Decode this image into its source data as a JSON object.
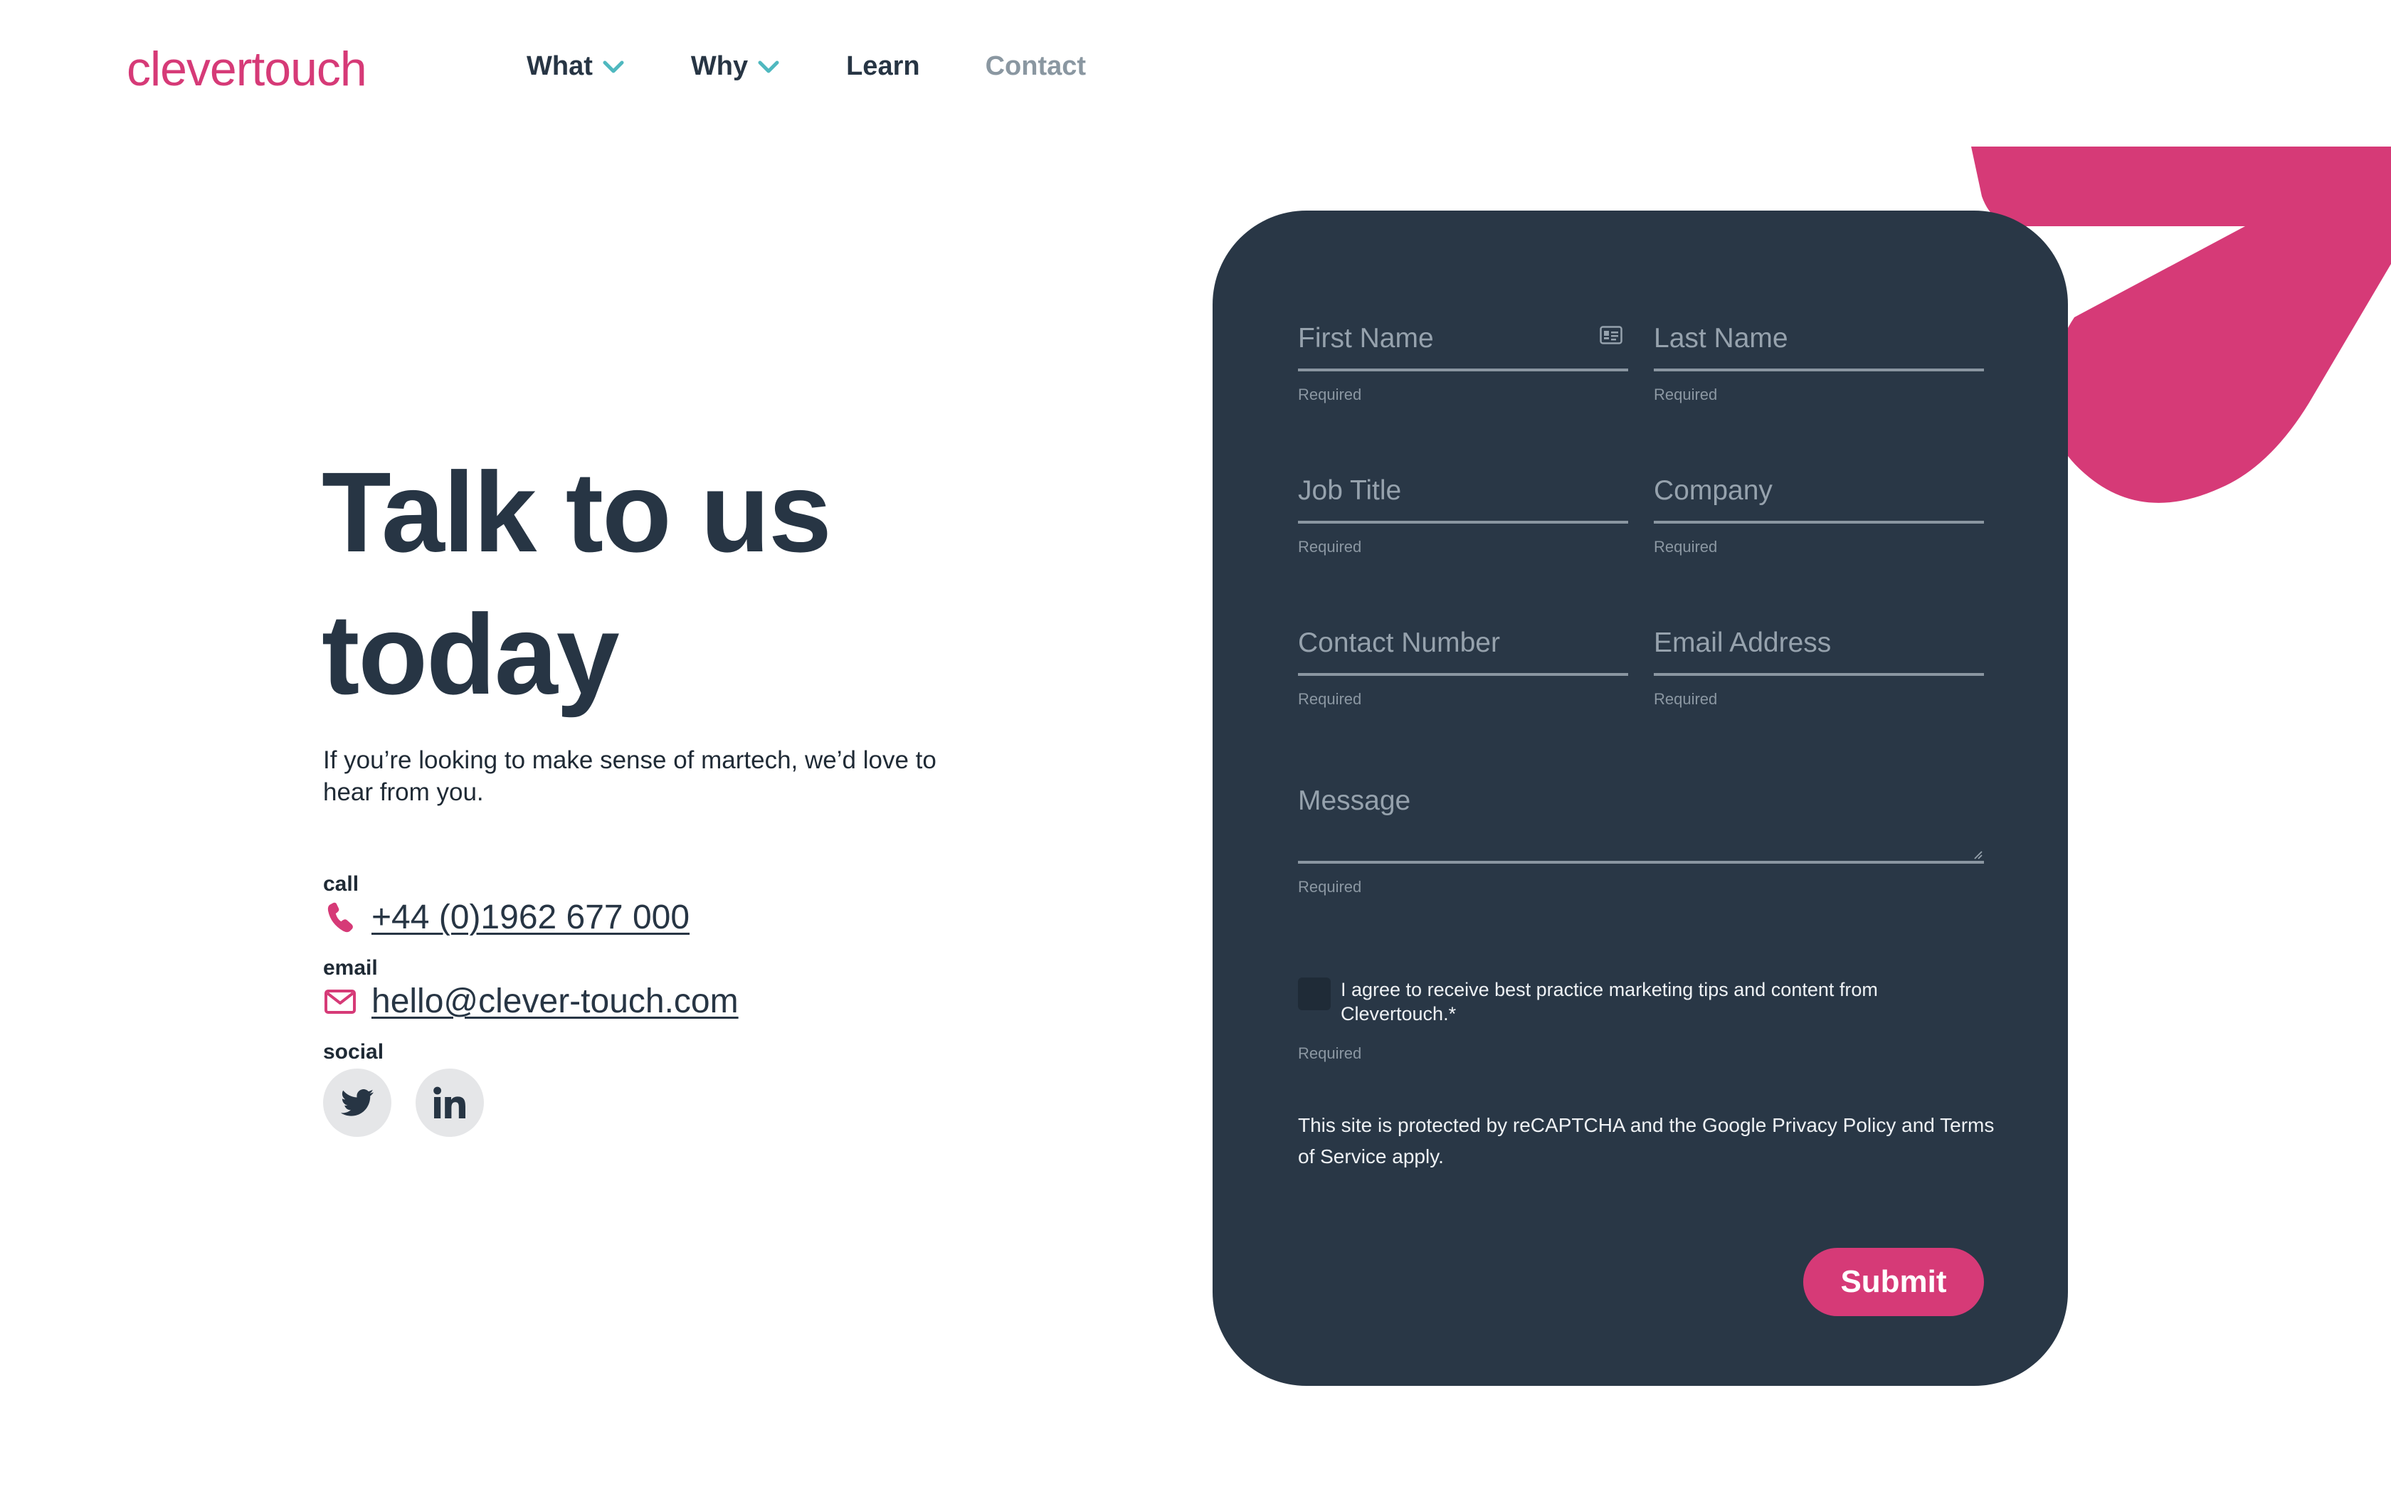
{
  "brand": {
    "logo_text": "clevertouch",
    "accent": "#d63a77",
    "dark": "#273544"
  },
  "nav": {
    "items": [
      {
        "label": "What",
        "has_dropdown": true
      },
      {
        "label": "Why",
        "has_dropdown": true
      },
      {
        "label": "Learn",
        "has_dropdown": false
      },
      {
        "label": "Contact",
        "has_dropdown": false,
        "active": true
      }
    ]
  },
  "hero": {
    "title_line1": "Talk to us",
    "title_line2": "today",
    "lead": "If you’re looking to make sense of martech, we’d love to hear from you."
  },
  "contact": {
    "call_label": "call",
    "phone": "+44 (0)1962 677 000",
    "email_label": "email",
    "email": "hello@clever-touch.com",
    "social_label": "social",
    "social": [
      {
        "icon": "twitter-icon"
      },
      {
        "icon": "linkedin-icon"
      }
    ]
  },
  "form": {
    "fields": {
      "first_name": {
        "placeholder": "First Name",
        "hint": "Required"
      },
      "last_name": {
        "placeholder": "Last Name",
        "hint": "Required"
      },
      "job_title": {
        "placeholder": "Job Title",
        "hint": "Required"
      },
      "company": {
        "placeholder": "Company",
        "hint": "Required"
      },
      "contact_number": {
        "placeholder": "Contact Number",
        "hint": "Required"
      },
      "email": {
        "placeholder": "Email Address",
        "hint": "Required"
      },
      "message": {
        "placeholder": "Message",
        "hint": "Required"
      }
    },
    "consent_text": "I agree to receive best practice marketing tips and content from Clevertouch.*",
    "consent_hint": "Required",
    "recaptcha_text": "This site is protected by reCAPTCHA and the Google Privacy Policy and Terms of Service apply.",
    "submit_label": "Submit"
  }
}
